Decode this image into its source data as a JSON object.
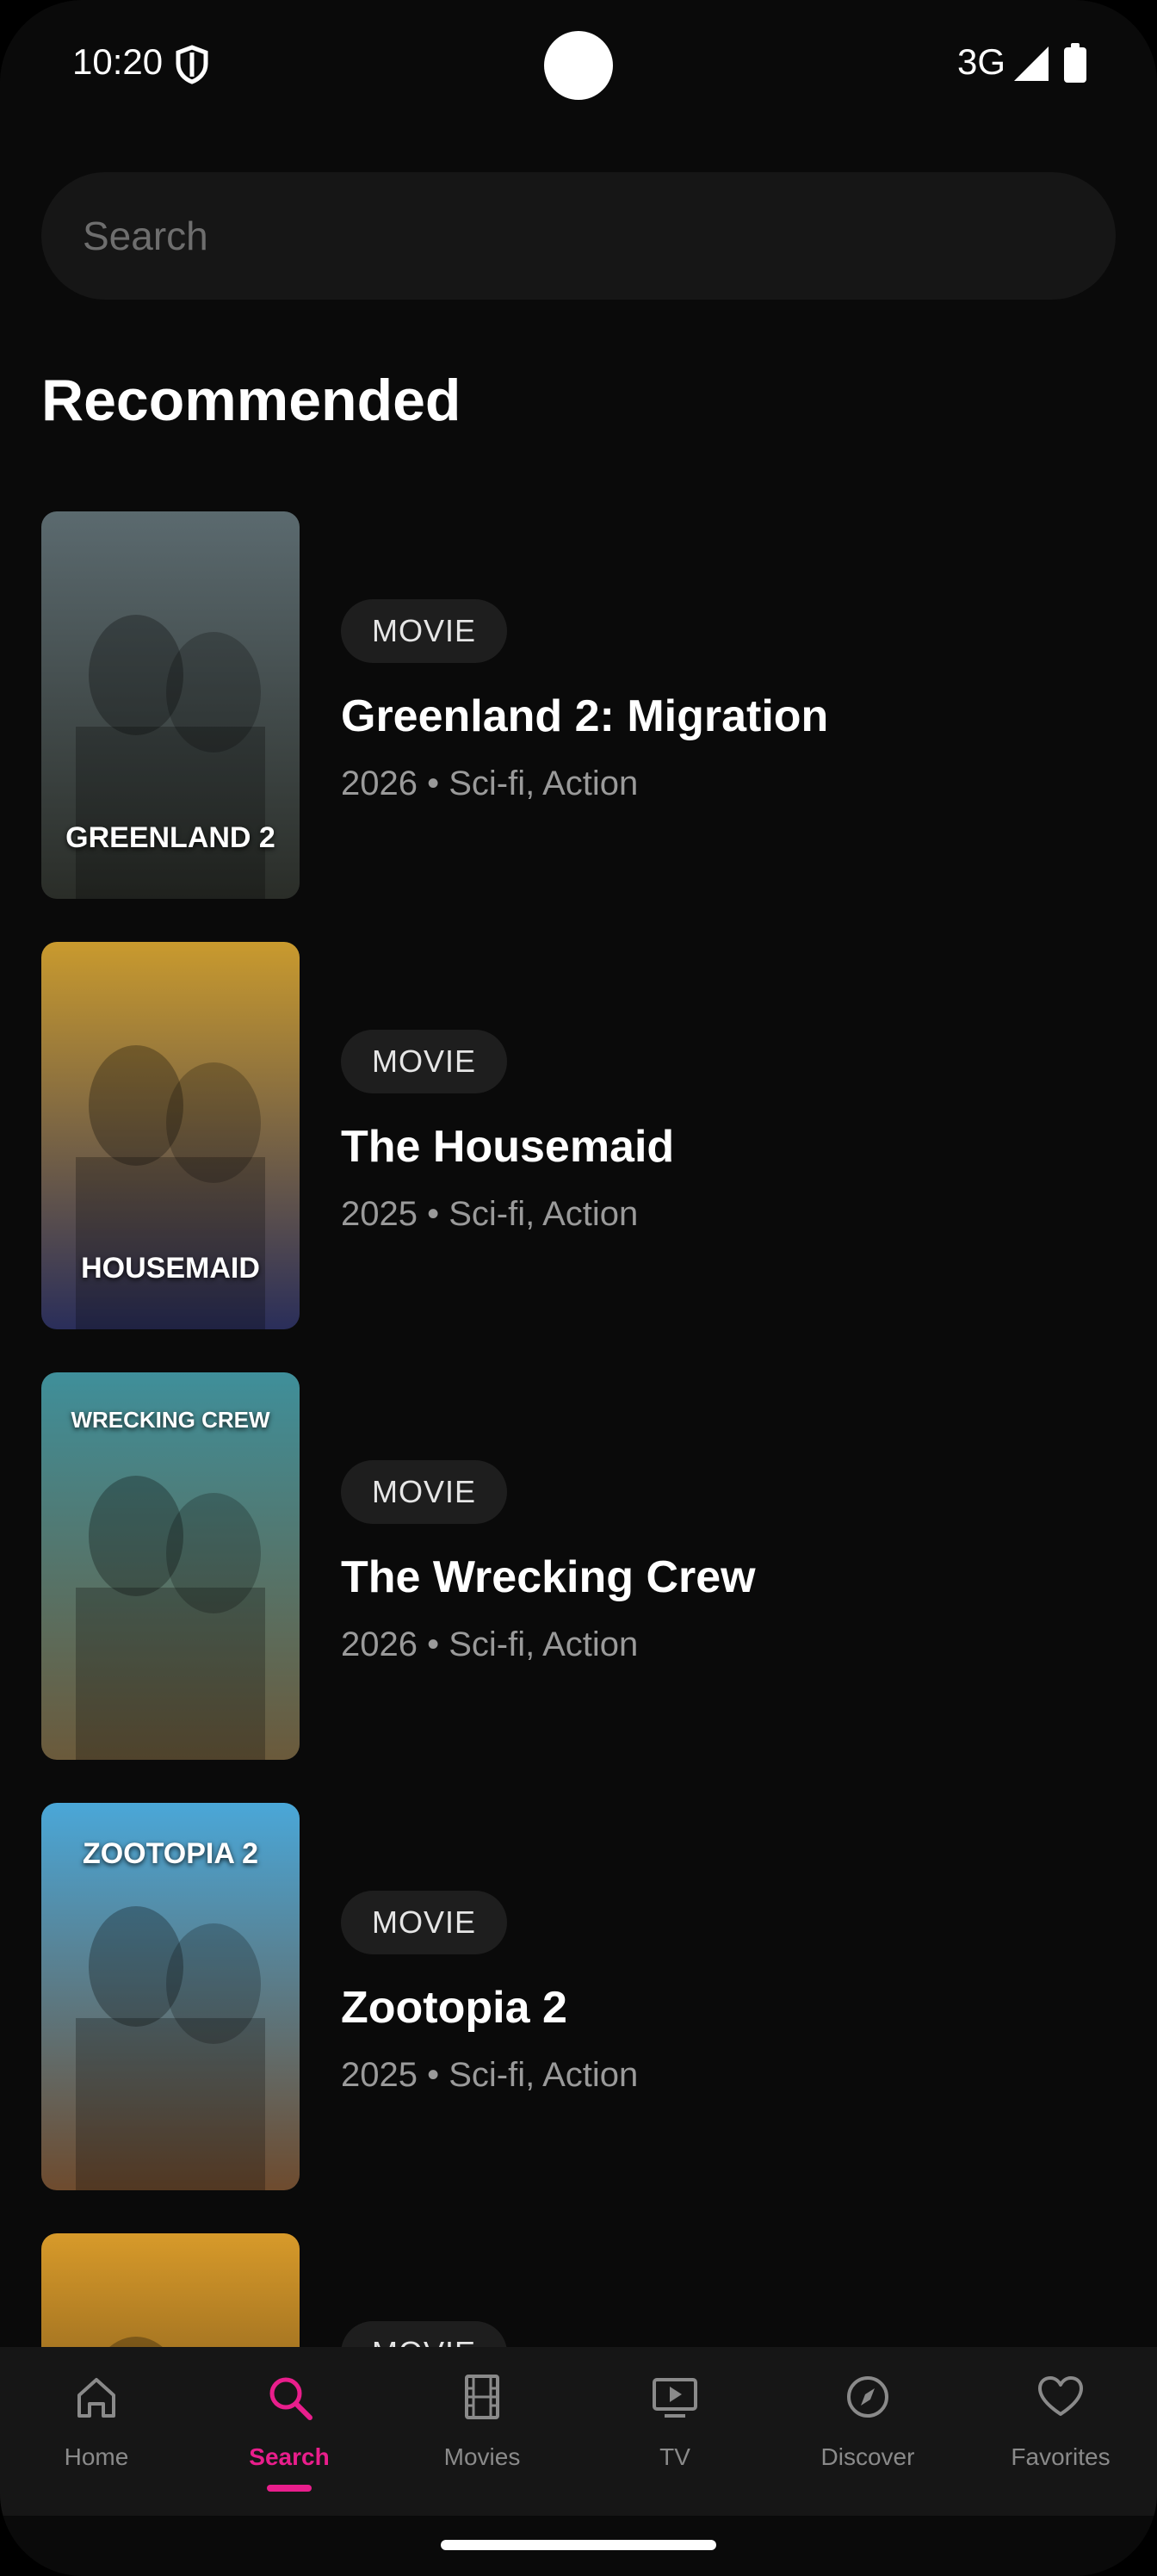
{
  "status_bar": {
    "time": "10:20",
    "network": "3G"
  },
  "search": {
    "placeholder": "Search",
    "value": ""
  },
  "section_title": "Recommended",
  "items": [
    {
      "type": "MOVIE",
      "title": "Greenland 2: Migration",
      "meta": "2026 • Sci-fi, Action",
      "poster_text": "GREENLAND 2",
      "poster_colors": [
        "#5b6a6f",
        "#2a2d28"
      ]
    },
    {
      "type": "MOVIE",
      "title": "The Housemaid",
      "meta": "2025 • Sci-fi, Action",
      "poster_text": "HOUSEMAID",
      "poster_colors": [
        "#c99a2e",
        "#2a2e5a"
      ]
    },
    {
      "type": "MOVIE",
      "title": "The Wrecking Crew",
      "meta": "2026 • Sci-fi, Action",
      "poster_text": "WRECKING CREW",
      "poster_colors": [
        "#3f8f9a",
        "#6b5a3b"
      ]
    },
    {
      "type": "MOVIE",
      "title": "Zootopia 2",
      "meta": "2025 • Sci-fi, Action",
      "poster_text": "ZOOTOPIA 2",
      "poster_colors": [
        "#4aa7d8",
        "#6e4b2e"
      ]
    },
    {
      "type": "MOVIE",
      "title": "",
      "meta": "",
      "poster_text": "",
      "poster_colors": [
        "#d79a2a",
        "#3a2410"
      ]
    }
  ],
  "nav": [
    {
      "label": "Home",
      "icon": "home-icon",
      "active": false
    },
    {
      "label": "Search",
      "icon": "search-icon",
      "active": true
    },
    {
      "label": "Movies",
      "icon": "film-icon",
      "active": false
    },
    {
      "label": "TV",
      "icon": "tv-icon",
      "active": false
    },
    {
      "label": "Discover",
      "icon": "compass-icon",
      "active": false
    },
    {
      "label": "Favorites",
      "icon": "heart-icon",
      "active": false
    }
  ],
  "colors": {
    "accent": "#e91e8c",
    "background": "#0a0a0a",
    "nav_background": "#161616"
  }
}
